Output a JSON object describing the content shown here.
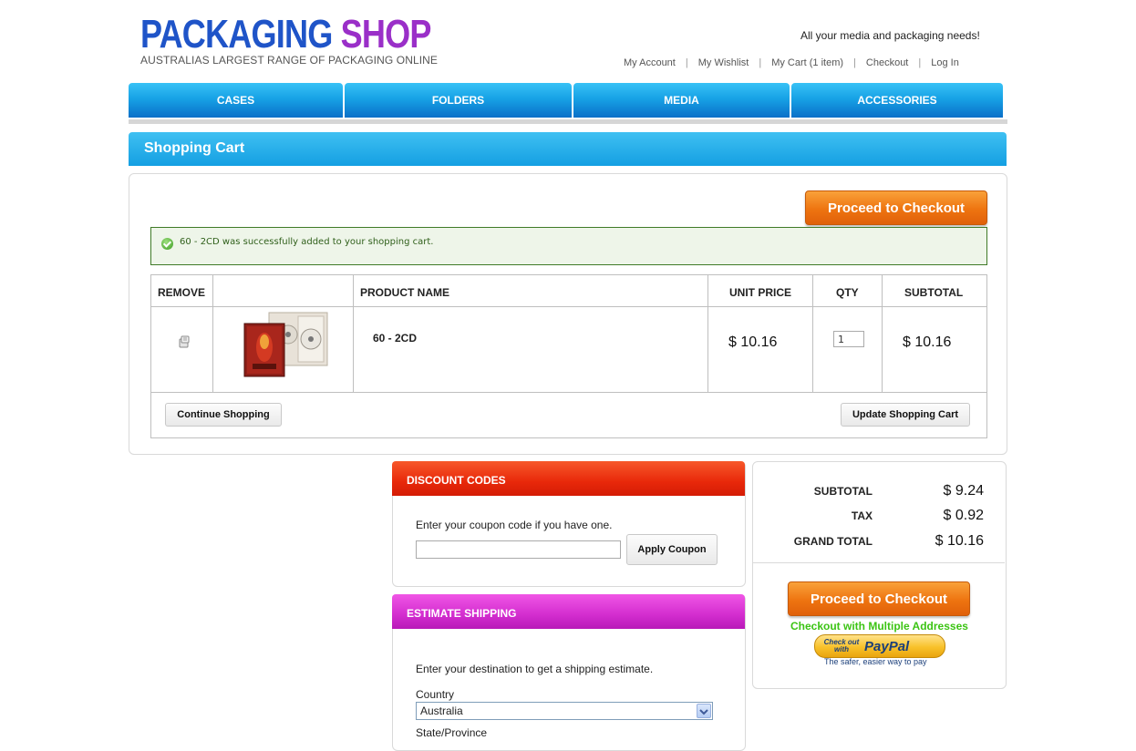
{
  "header": {
    "logo_word1": "PACKAGING",
    "logo_word2": "SHOP",
    "logo_sub": "AUSTRALIAS LARGEST RANGE OF PACKAGING ONLINE",
    "tagline": "All your media and packaging needs!",
    "links": [
      "My Account",
      "My Wishlist",
      "My Cart (1 item)",
      "Checkout",
      "Log In"
    ]
  },
  "nav": [
    "CASES",
    "FOLDERS",
    "MEDIA",
    "ACCESSORIES"
  ],
  "cart": {
    "title": "Shopping Cart",
    "proceed_label": "Proceed to Checkout",
    "success_message": "60 - 2CD was successfully added to your shopping cart.",
    "columns": [
      "REMOVE",
      "",
      "PRODUCT NAME",
      "UNIT PRICE",
      "QTY",
      "SUBTOTAL"
    ],
    "item": {
      "name": "60 - 2CD",
      "unit_price": "$ 10.16",
      "qty": "1",
      "subtotal": "$ 10.16"
    },
    "continue_label": "Continue Shopping",
    "update_label": "Update Shopping Cart"
  },
  "discount": {
    "title": "DISCOUNT CODES",
    "prompt": "Enter your coupon code if you have one.",
    "coupon_value": "",
    "apply_label": "Apply Coupon"
  },
  "shipping": {
    "title": "ESTIMATE SHIPPING",
    "prompt": "Enter your destination to get a shipping estimate.",
    "country_label": "Country",
    "country_value": "Australia",
    "state_label": "State/Province"
  },
  "totals": {
    "subtotal_label": "SUBTOTAL",
    "subtotal_value": "$ 9.24",
    "tax_label": "TAX",
    "tax_value": "$ 0.92",
    "grand_label": "GRAND TOTAL",
    "grand_value": "$ 10.16",
    "proceed_label": "Proceed to Checkout",
    "multi_address": "Checkout with Multiple Addresses",
    "paypal_small": "Check out with",
    "paypal_brand": "PayPal",
    "paypal_tagline": "The safer, easier way to pay"
  },
  "colors": {
    "nav_blue": "#17a2e6",
    "checkout_orange": "#ee7410",
    "discount_red": "#e8280a",
    "shipping_magenta": "#d32dcf",
    "success_green": "#3f7a27",
    "multi_address_green": "#3cc414"
  }
}
